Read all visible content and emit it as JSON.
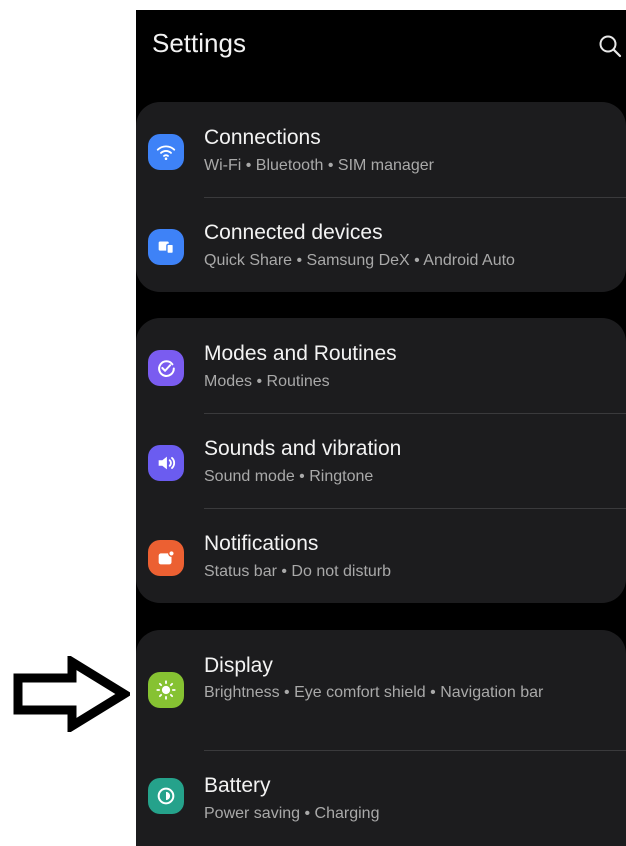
{
  "header": {
    "title": "Settings"
  },
  "groups": [
    {
      "items": [
        {
          "label": "Connections",
          "sub": "Wi-Fi  •  Bluetooth  •  SIM manager",
          "icon": "wifi-icon",
          "color": "#3e82f7"
        },
        {
          "label": "Connected devices",
          "sub": "Quick Share  •  Samsung DeX  •  Android Auto",
          "icon": "devices-icon",
          "color": "#3e82f7"
        }
      ]
    },
    {
      "items": [
        {
          "label": "Modes and Routines",
          "sub": "Modes  •  Routines",
          "icon": "check-circle-icon",
          "color": "#7a5cf0"
        },
        {
          "label": "Sounds and vibration",
          "sub": "Sound mode  •  Ringtone",
          "icon": "speaker-icon",
          "color": "#6b5cf0"
        },
        {
          "label": "Notifications",
          "sub": "Status bar  •  Do not disturb",
          "icon": "notification-icon",
          "color": "#ec6032"
        }
      ]
    },
    {
      "items": [
        {
          "label": "Display",
          "sub": "Brightness  •  Eye comfort shield  •  Navigation bar",
          "icon": "brightness-icon",
          "color": "#86c232"
        },
        {
          "label": "Battery",
          "sub": "Power saving  •  Charging",
          "icon": "battery-icon",
          "color": "#25a28b"
        }
      ]
    }
  ]
}
